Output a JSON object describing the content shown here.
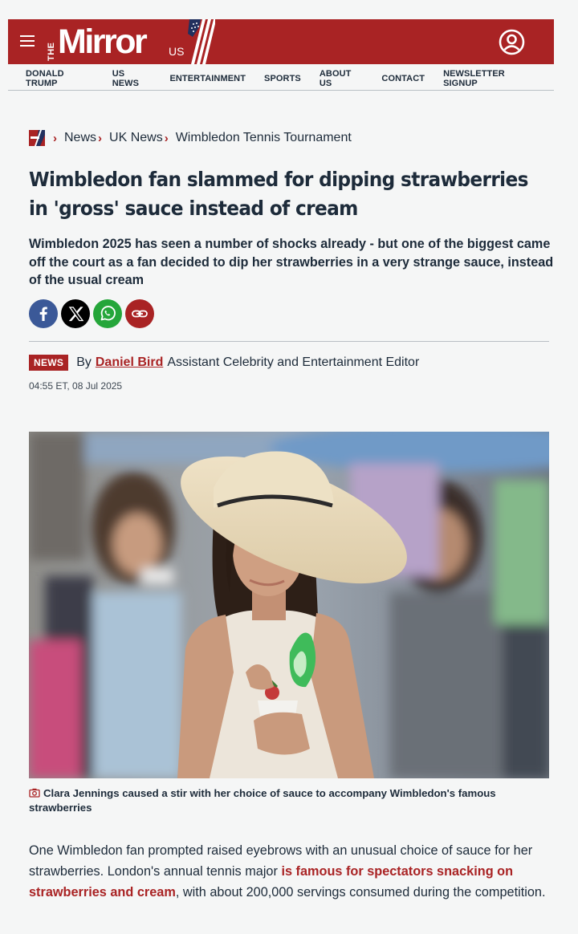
{
  "header": {
    "logo_the": "THE",
    "logo_word": "Mirror",
    "logo_region": "US",
    "brand_color": "#a92324"
  },
  "topnav": {
    "items": [
      "DONALD TRUMP",
      "US NEWS",
      "ENTERTAINMENT",
      "SPORTS",
      "ABOUT US",
      "CONTACT",
      "NEWSLETTER SIGNUP"
    ]
  },
  "breadcrumb": {
    "items": [
      "News",
      "UK News",
      "Wimbledon Tennis Tournament"
    ]
  },
  "article": {
    "headline": "Wimbledon fan slammed for dipping strawberries in 'gross' sauce instead of cream",
    "standfirst": "Wimbledon 2025 has seen a number of shocks already - but one of the biggest came off the court as a fan decided to dip her strawberries in a very strange sauce, instead of the usual cream",
    "share": {
      "icons": [
        "facebook-icon",
        "x-icon",
        "whatsapp-icon",
        "link-icon"
      ],
      "colors": [
        "#3b5998",
        "#000000",
        "#25a63a",
        "#a92324"
      ]
    },
    "tag": "NEWS",
    "by_label": "By",
    "author": "Daniel Bird",
    "author_role": "Assistant Celebrity and Entertainment Editor",
    "timestamp": "04:55 ET, 08 Jul 2025",
    "image_caption": "Clara Jennings caused a stir with her choice of sauce to accompany Wimbledon's famous strawberries",
    "body": {
      "text_before": "One Wimbledon fan prompted raised eyebrows with an unusual choice of sauce for her strawberries. London's annual tennis major ",
      "link_text": "is famous for spectators snacking on strawberries and cream",
      "text_after": ", with about 200,000 servings consumed during the competition."
    }
  }
}
